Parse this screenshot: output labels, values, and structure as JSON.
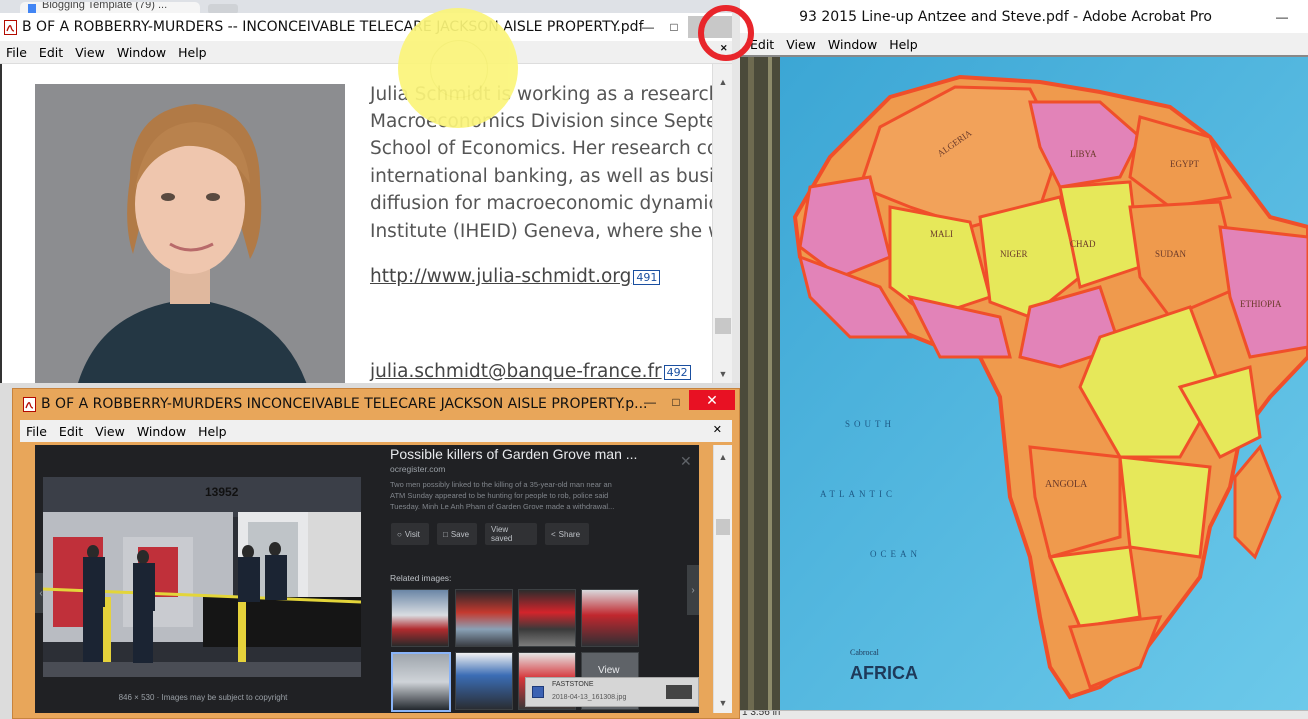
{
  "background_tab": {
    "title": "Blogging Template (79) ..."
  },
  "win_top_left": {
    "title": "B OF A ROBBERRY-MURDERS -- INCONCEIVABLE TELECARE  JACKSON AISLE PROPERTY.pdf",
    "menu": [
      "File",
      "Edit",
      "View",
      "Window",
      "Help"
    ],
    "bio_lines": [
      "Julia Schmidt is working as a research",
      "Macroeconomics Division since Septe",
      "School of Economics. Her research co",
      "international banking, as well as busi",
      "diffusion for macroeconomic dynamic",
      "Institute (IHEID) Geneva, where she w"
    ],
    "link_url": "http://www.julia-schmidt.org",
    "link_url_badge": "491",
    "email": "julia.schmidt@banque-france.fr",
    "email_badge": "492"
  },
  "win_right": {
    "title": "93 2015 Line-up Antzee and Steve.pdf - Adobe Acrobat Pro",
    "menu": [
      "Edit",
      "View",
      "Window",
      "Help"
    ],
    "map_text": {
      "south": "SOUTH",
      "atlantic": "ATLANTIC",
      "ocean": "OCEAN",
      "caption_small": "Cabrocal",
      "caption_big": "AFRICA",
      "countries": [
        "ALGERIA",
        "LIBYA",
        "MALI",
        "NIGER",
        "CHAD",
        "SUDAN",
        "ETHIOPIA",
        "ANGOLA",
        "EGYPT"
      ]
    },
    "status": "1 3.56 in"
  },
  "win_bottom": {
    "title": "B OF A ROBBERRY-MURDERS  INCONCEIVABLE TELECARE  JACKSON AISLE PROPERTY.p...",
    "menu": [
      "File",
      "Edit",
      "View",
      "Window",
      "Help"
    ],
    "search_panel": {
      "headline": "Possible killers of Garden Grove man ...",
      "source": "ocregister.com",
      "snippet_lines": [
        "Two men possibly linked to the killing of a 35-year-old man near an",
        "ATM Sunday appeared to be hunting for people to rob, police said",
        "Tuesday. Minh Le Anh Pham of Garden Grove made a withdrawal..."
      ],
      "buttons": [
        "Visit",
        "Save",
        "View saved",
        "Share"
      ],
      "related_label": "Related images:",
      "image_caption": "846 × 530 · Images may be subject to copyright",
      "atm_number": "13952",
      "view_overlay": "View",
      "toast_title": "FASTSTONE",
      "toast_file": "2018-04-13_161308.jpg"
    }
  },
  "colors": {
    "accent_orange": "#e8a65a",
    "close_red": "#e81123",
    "cursor_yellow": "#fbf57a",
    "cursor_red": "#e8252b",
    "map_ocean": "#4db8e0",
    "map_yellow": "#e6e85a",
    "map_orange": "#f29a4a",
    "map_pink": "#e283b8"
  }
}
